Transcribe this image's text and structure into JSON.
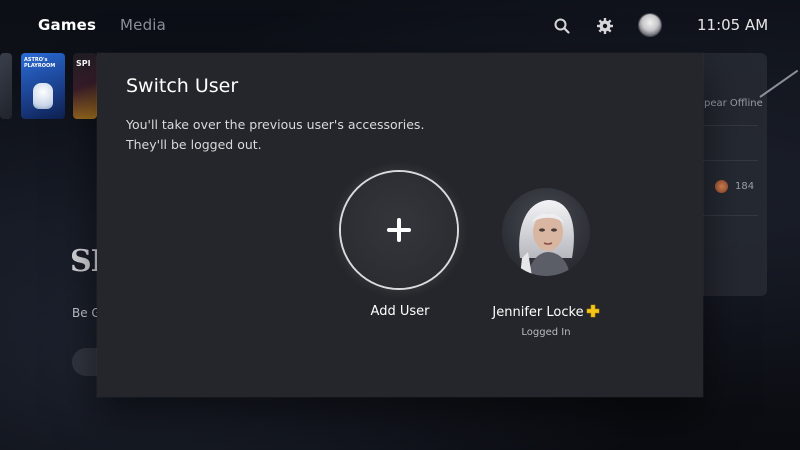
{
  "topnav": {
    "tabs": [
      {
        "label": "Games",
        "active": true
      },
      {
        "label": "Media",
        "active": false
      }
    ],
    "icons": [
      "search-icon",
      "gear-icon",
      "profile-avatar"
    ],
    "clock": "11:05 AM"
  },
  "background": {
    "tiles": {
      "astro_label": "ASTRO's PLAYROOM",
      "spider_label": "SPI"
    },
    "side_panel": {
      "status_text": "pear Offline",
      "trophy_count": "184"
    },
    "hero": {
      "logo_text": "SP",
      "subtitle": "Be G"
    }
  },
  "dialog": {
    "title": "Switch User",
    "description_line1": "You'll take over the previous user's accessories.",
    "description_line2": "They'll be logged out.",
    "options": [
      {
        "label": "Add User",
        "icon": "plus-icon",
        "focused": true
      },
      {
        "label": "Jennifer Locke",
        "status": "Logged In",
        "badge": "ps-plus-icon"
      }
    ]
  },
  "colors": {
    "dialog_bg": "#24262b",
    "ps_plus": "#f5c518",
    "focus_ring": "#d9dadd"
  }
}
